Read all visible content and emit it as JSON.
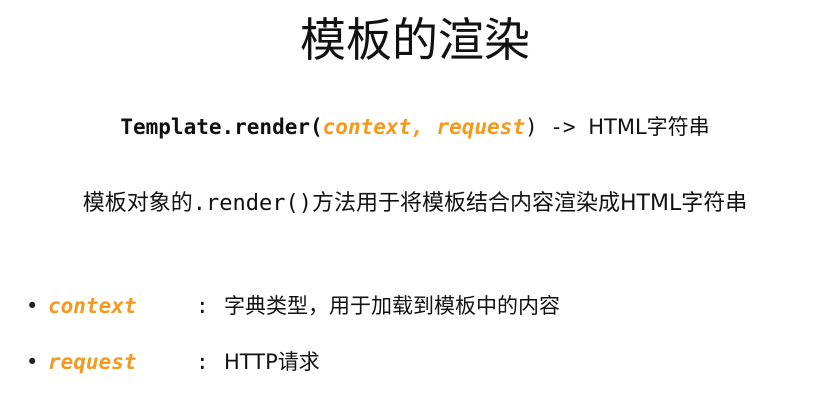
{
  "slide": {
    "title": "模板的渲染",
    "signature": {
      "method": "Template.render(",
      "arg1": "context,",
      "arg2": "request",
      "close": ") -> ",
      "returns": "HTML字符串"
    },
    "description": {
      "before": "模板对象的",
      "code": ".render()",
      "after": "方法用于将模板结合内容渲染成HTML字符串"
    },
    "bullets": [
      {
        "term": "context",
        "colon": ":",
        "text": "字典类型，用于加载到模板中的内容"
      },
      {
        "term": "request",
        "colon": ":",
        "text": "HTTP请求"
      }
    ]
  },
  "colors": {
    "accent": "#f39a1e",
    "text": "#111111",
    "background": "#ffffff"
  }
}
